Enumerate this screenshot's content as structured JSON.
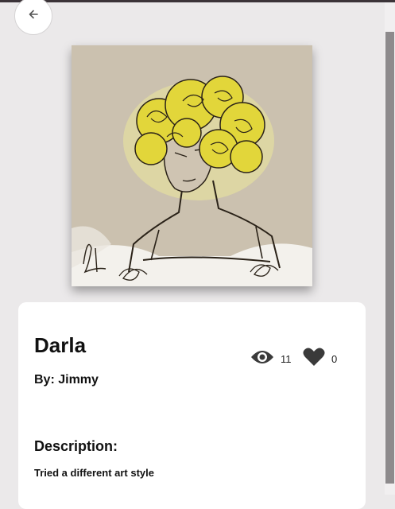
{
  "artwork": {
    "title": "Darla",
    "author_prefix": "By:",
    "author": "Jimmy",
    "byline": "By: Jimmy"
  },
  "stats": {
    "views": "11",
    "likes": "0",
    "views_icon": "eye-icon",
    "likes_icon": "heart-icon"
  },
  "description": {
    "heading": "Description:",
    "text": "Tried a different art style"
  },
  "nav": {
    "back_icon": "arrow-left-icon"
  },
  "colors": {
    "background": "#ebe9ea",
    "card": "#ffffff",
    "artwork_bg": "#cbc1af",
    "hair": "#e2d63a",
    "icon": "#3a3a3a"
  }
}
